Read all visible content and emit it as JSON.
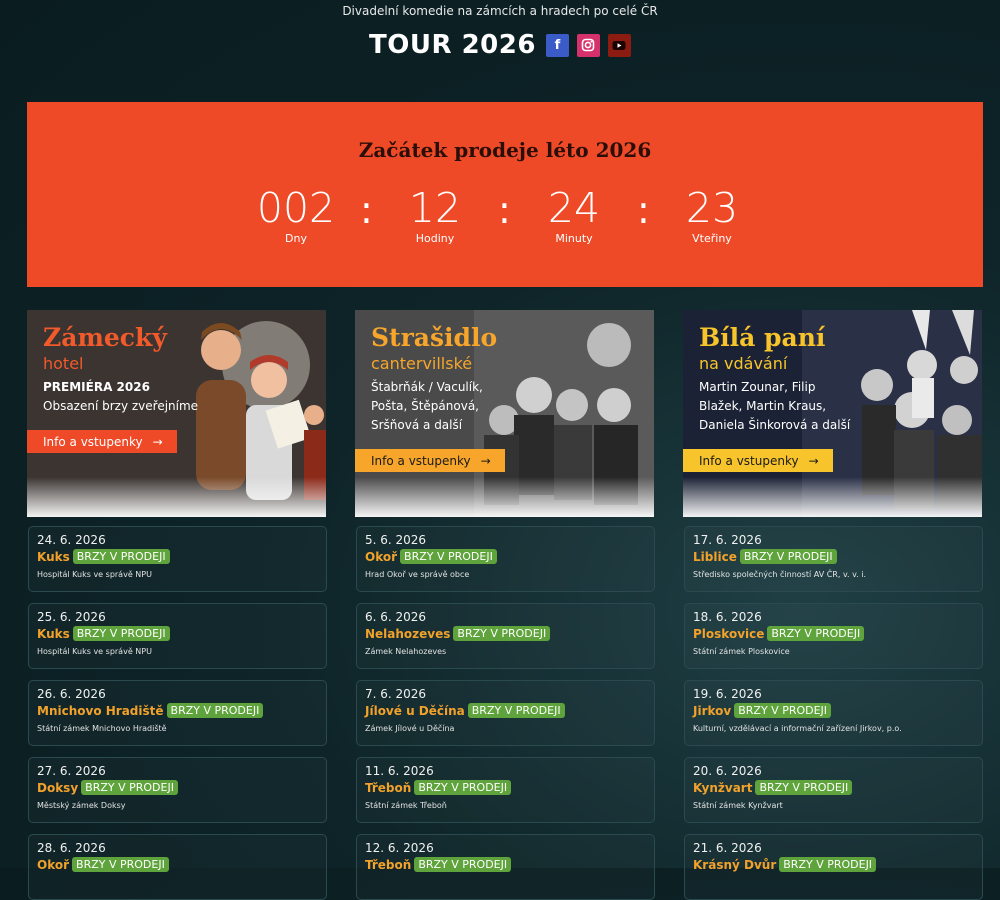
{
  "header": {
    "subtitle": "Divadelní komedie na zámcích a hradech po celé ČR",
    "title": "TOUR 2026",
    "social": [
      "facebook-icon",
      "instagram-icon",
      "youtube-icon"
    ]
  },
  "countdown": {
    "title": "Začátek prodeje léto 2026",
    "units": [
      {
        "value": "002",
        "label": "Dny"
      },
      {
        "value": "12",
        "label": "Hodiny"
      },
      {
        "value": "24",
        "label": "Minuty"
      },
      {
        "value": "23",
        "label": "Vteřiny"
      }
    ],
    "separator": ":"
  },
  "colors": {
    "banner": "#ee4a28",
    "accent_orange": "#f2a22a",
    "badge_green": "#5ea33b",
    "yellow": "#f7c52b"
  },
  "shows": [
    {
      "title": "Zámecký",
      "subtitle": "hotel",
      "lines": [
        "PREMIÉRA 2026",
        "Obsazení brzy zveřejníme"
      ],
      "button": "Info a vstupenky",
      "arrow": "→"
    },
    {
      "title": "Strašidlo",
      "subtitle": "cantervillské",
      "lines": [
        "Štabrňák / Vaculík,",
        "Pošta, Štěpánová,",
        "Sršňová a další"
      ],
      "button": "Info a vstupenky",
      "arrow": "→"
    },
    {
      "title": "Bílá paní",
      "subtitle": "na vdávání",
      "lines": [
        "Martin Zounar, Filip",
        "Blažek, Martin Kraus,",
        "Daniela Šinkorová a další"
      ],
      "button": "Info a vstupenky",
      "arrow": "→"
    }
  ],
  "events": [
    [
      {
        "date": "24. 6. 2026",
        "place": "Kuks",
        "badge": "BRZY V PRODEJI",
        "venue": "Hospitál Kuks ve správě NPU"
      },
      {
        "date": "25. 6. 2026",
        "place": "Kuks",
        "badge": "BRZY V PRODEJI",
        "venue": "Hospitál Kuks ve správě NPU"
      },
      {
        "date": "26. 6. 2026",
        "place": "Mnichovo Hradiště",
        "badge": "BRZY V PRODEJI",
        "venue": "Státní zámek Mnichovo Hradiště"
      },
      {
        "date": "27. 6. 2026",
        "place": "Doksy",
        "badge": "BRZY V PRODEJI",
        "venue": "Městský zámek Doksy"
      },
      {
        "date": "28. 6. 2026",
        "place": "Okoř",
        "badge": "BRZY V PRODEJI",
        "venue": ""
      }
    ],
    [
      {
        "date": "5. 6. 2026",
        "place": "Okoř",
        "badge": "BRZY V PRODEJI",
        "venue": "Hrad Okoř ve správě obce"
      },
      {
        "date": "6. 6. 2026",
        "place": "Nelahozeves",
        "badge": "BRZY V PRODEJI",
        "venue": "Zámek Nelahozeves"
      },
      {
        "date": "7. 6. 2026",
        "place": "Jílové u Děčína",
        "badge": "BRZY V PRODEJI",
        "venue": "Zámek Jílové u Děčína"
      },
      {
        "date": "11. 6. 2026",
        "place": "Třeboň",
        "badge": "BRZY V PRODEJI",
        "venue": "Státní zámek Třeboň"
      },
      {
        "date": "12. 6. 2026",
        "place": "Třeboň",
        "badge": "BRZY V PRODEJI",
        "venue": ""
      }
    ],
    [
      {
        "date": "17. 6. 2026",
        "place": "Liblice",
        "badge": "BRZY V PRODEJI",
        "venue": "Středisko společných činností AV ČR, v. v. i."
      },
      {
        "date": "18. 6. 2026",
        "place": "Ploskovice",
        "badge": "BRZY V PRODEJI",
        "venue": "Státní zámek Ploskovice"
      },
      {
        "date": "19. 6. 2026",
        "place": "Jirkov",
        "badge": "BRZY V PRODEJI",
        "venue": "Kulturní, vzdělávací a informační zařízení Jirkov, p.o."
      },
      {
        "date": "20. 6. 2026",
        "place": "Kynžvart",
        "badge": "BRZY V PRODEJI",
        "venue": "Státní zámek Kynžvart"
      },
      {
        "date": "21. 6. 2026",
        "place": "Krásný Dvůr",
        "badge": "BRZY V PRODEJI",
        "venue": ""
      }
    ]
  ]
}
